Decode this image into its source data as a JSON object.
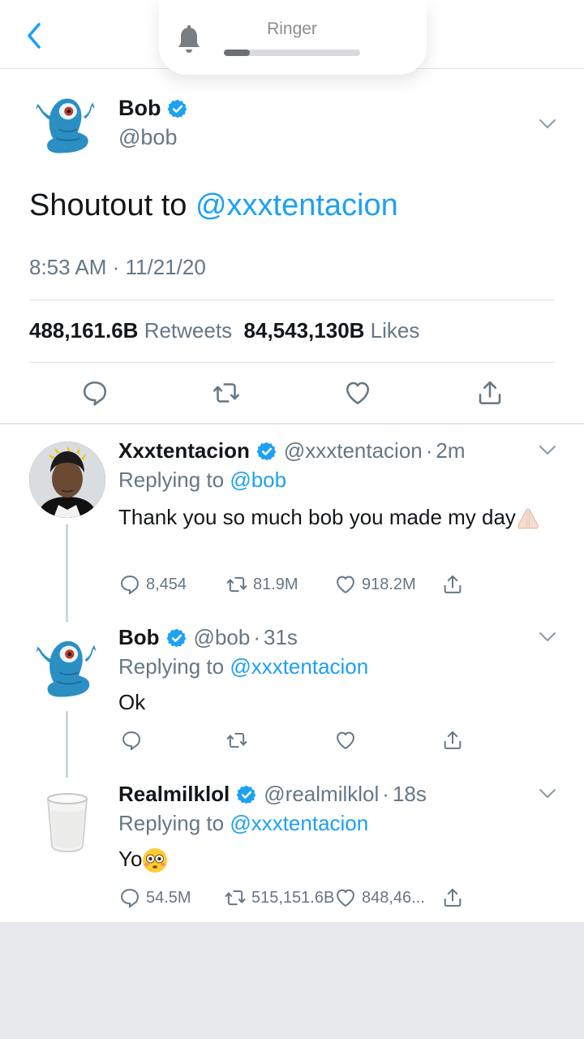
{
  "hud": {
    "label": "Ringer",
    "volume_fraction": 0.19
  },
  "colors": {
    "accent": "#1da1f2",
    "text": "#14171a",
    "muted": "#657786",
    "avatar_blue": "#2b8fc4"
  },
  "main_tweet": {
    "name": "Bob",
    "handle": "@bob",
    "text_prefix": "Shoutout to ",
    "mention": "@xxxtentacion",
    "timestamp": "8:53 AM · 11/21/20",
    "retweets_count": "488,161.6B",
    "retweets_label": "Retweets",
    "likes_count": "84,543,130B",
    "likes_label": "Likes"
  },
  "replies": [
    {
      "name": "Xxxtentacion",
      "handle": "@xxxtentacion",
      "time": "2m",
      "replying_prefix": "Replying to",
      "replying_to": "@bob",
      "text": "Thank you so much bob you made my day",
      "emoji": "folded-hands",
      "reply_count": "8,454",
      "retweet_count": "81.9M",
      "like_count": "918.2M"
    },
    {
      "name": "Bob",
      "handle": "@bob",
      "time": "31s",
      "replying_prefix": "Replying to",
      "replying_to": "@xxxtentacion",
      "text": "Ok",
      "reply_count": "",
      "retweet_count": "",
      "like_count": ""
    },
    {
      "name": "Realmilklol",
      "handle": "@realmilklol",
      "time": "18s",
      "replying_prefix": "Replying to",
      "replying_to": "@xxxtentacion",
      "text": "Yo",
      "emoji": "flushed-face",
      "reply_count": "54.5M",
      "retweet_count": "515,151.6B",
      "like_count": "848,46..."
    }
  ],
  "icons": [
    "back-chevron-icon",
    "bell-icon",
    "verified-badge-icon",
    "chevron-down-icon",
    "reply-icon",
    "retweet-icon",
    "like-icon",
    "share-icon"
  ]
}
